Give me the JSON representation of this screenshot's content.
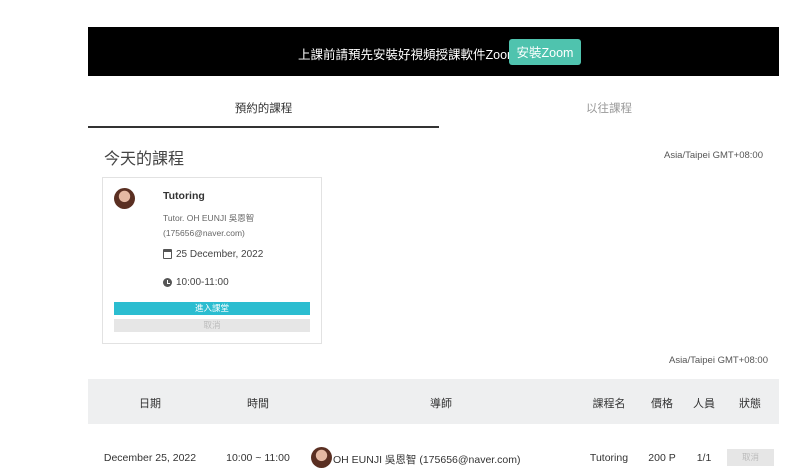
{
  "banner": {
    "message": "上課前請預先安裝好視頻授課軟件Zoom。",
    "button_label": "安裝Zoom"
  },
  "tabs": [
    {
      "label": "預約的課程",
      "active": true
    },
    {
      "label": "以往課程",
      "active": false
    }
  ],
  "today": {
    "title": "今天的課程",
    "timezone": "Asia/Taipei GMT+08:00",
    "card": {
      "course": "Tutoring",
      "tutor_line1": "Tutor. OH EUNJI 吳恩智",
      "tutor_line2": "(175656@naver.com)",
      "date": "25 December, 2022",
      "time": "10:00-11:00",
      "enter_label": "進入課堂",
      "cancel_label": "取消"
    }
  },
  "table": {
    "timezone": "Asia/Taipei GMT+08:00",
    "headers": [
      "日期",
      "時間",
      "導師",
      "課程名",
      "價格",
      "人員",
      "狀態"
    ],
    "rows": [
      {
        "date": "December 25, 2022",
        "time": "10:00 ~ 11:00",
        "tutor": "OH EUNJI 吳恩智 (175656@naver.com)",
        "course": "Tutoring",
        "price": "200 P",
        "people": "1/1",
        "status_label": "取消"
      }
    ]
  },
  "colors": {
    "banner_bg": "#000000",
    "install_button": "#4fc3ae",
    "enter_button": "#2bbdd0",
    "disabled_button": "#e6e6e6"
  }
}
